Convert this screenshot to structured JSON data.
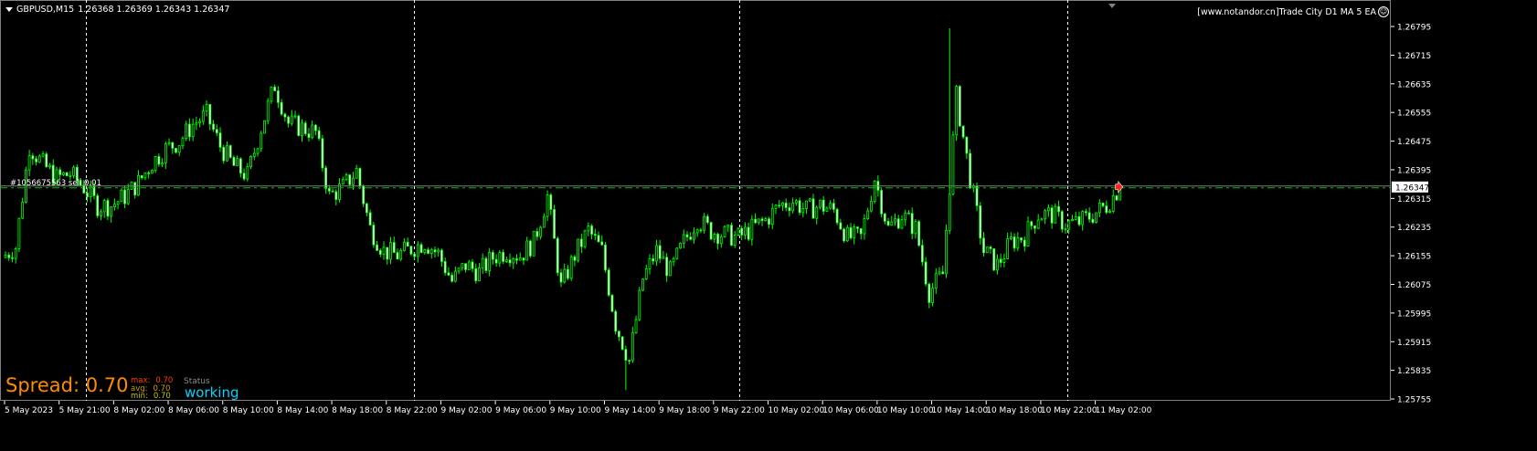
{
  "header": {
    "symbol": "GBPUSD,M15",
    "ohlc": "1.26368 1.26369 1.26343 1.26347"
  },
  "ea_label": "[www.notandor.cn]Trade City D1 MA 5 EA",
  "order_label": "#1056675563 sell 0.01",
  "spread": {
    "label": "Spread: 0.70",
    "max_label": "max:",
    "max": "0.70",
    "avg_label": "avg:",
    "avg": "0.70",
    "min_label": "min:",
    "min": "0.70",
    "status_label": "Status",
    "status": "working"
  },
  "colors": {
    "background": "#000000",
    "candle": "#00ff00",
    "bull_fill": "#000000",
    "bear_fill": "#ffffff",
    "grid_separator": "#ffffff",
    "bid_line": "#808080",
    "order_line": "#00c000",
    "spread": "#ff8c00",
    "max": "#ff3c00",
    "avg": "#c8a000",
    "min": "#c8c800",
    "status": "#00d4ff"
  },
  "chart_data": {
    "type": "candlestick",
    "timeframe": "M15",
    "ylim": [
      1.2575,
      1.26869
    ],
    "current_price": "1.26347",
    "y_ticks": [
      "1.26795",
      "1.26715",
      "1.26635",
      "1.26555",
      "1.26475",
      "1.26395",
      "1.26315",
      "1.26235",
      "1.26155",
      "1.26075",
      "1.25995",
      "1.25915",
      "1.25835",
      "1.25755"
    ],
    "x_ticks": [
      "5 May 2023",
      "5 May 21:00",
      "8 May 02:00",
      "8 May 06:00",
      "8 May 10:00",
      "8 May 14:00",
      "8 May 18:00",
      "8 May 22:00",
      "9 May 02:00",
      "9 May 06:00",
      "9 May 10:00",
      "9 May 14:00",
      "9 May 18:00",
      "9 May 22:00",
      "10 May 02:00",
      "10 May 06:00",
      "10 May 10:00",
      "10 May 14:00",
      "10 May 18:00",
      "10 May 22:00",
      "11 May 02:00"
    ],
    "hourly_closes": [
      1.2618,
      1.26461,
      1.2641,
      1.26372,
      1.26384,
      1.26346,
      1.26295,
      1.26295,
      1.26321,
      1.26359,
      1.26415,
      1.26453,
      1.26474,
      1.26522,
      1.26548,
      1.26461,
      1.26405,
      1.26379,
      1.26512,
      1.26632,
      1.26525,
      1.26512,
      1.26499,
      1.26321,
      1.26346,
      1.26392,
      1.26231,
      1.26168,
      1.26157,
      1.26175,
      1.26193,
      1.2616,
      1.26084,
      1.26129,
      1.26109,
      1.2615,
      1.26168,
      1.26155,
      1.26193,
      1.26321,
      1.26066,
      1.26157,
      1.26226,
      1.26168,
      1.25964,
      1.25862,
      1.26091,
      1.26168,
      1.26109,
      1.26193,
      1.26257,
      1.26224,
      1.26214,
      1.26206,
      1.26231,
      1.26254,
      1.26295,
      1.26308,
      1.26282,
      1.26295,
      1.26282,
      1.26206,
      1.26206,
      1.26372,
      1.26231,
      1.2627,
      1.26231,
      1.26053,
      1.26104,
      1.266,
      1.26372,
      1.26168,
      1.26129,
      1.26193,
      1.26211,
      1.2627,
      1.2627,
      1.26244,
      1.26249,
      1.2627,
      1.26295,
      1.26347
    ],
    "extreme_high": 1.2679,
    "extreme_low": 1.2578
  }
}
